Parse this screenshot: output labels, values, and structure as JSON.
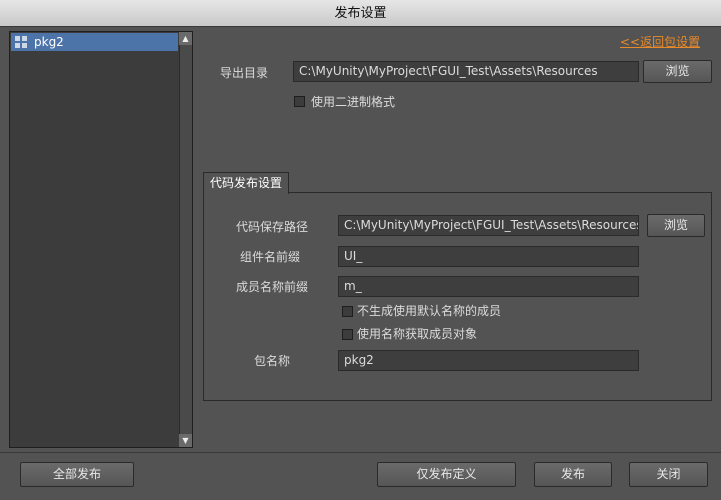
{
  "window": {
    "title": "发布设置"
  },
  "packages": {
    "items": [
      {
        "label": "pkg2",
        "icon": "package-grid-icon"
      }
    ]
  },
  "back_link": "<<返回包设置",
  "export": {
    "label": "导出目录",
    "path": "C:\\MyUnity\\MyProject\\FGUI_Test\\Assets\\Resources",
    "browse": "浏览",
    "binary_format": "使用二进制格式"
  },
  "code": {
    "tab": "代码发布设置",
    "path_label": "代码保存路径",
    "path": "C:\\MyUnity\\MyProject\\FGUI_Test\\Assets\\Resources",
    "browse": "浏览",
    "component_prefix_label": "组件名前缀",
    "component_prefix": "UI_",
    "member_prefix_label": "成员名称前缀",
    "member_prefix": "m_",
    "no_default_name_members": "不生成使用默认名称的成员",
    "get_members_by_name": "使用名称获取成员对象",
    "package_name_label": "包名称",
    "package_name": "pkg2"
  },
  "footer": {
    "publish_all": "全部发布",
    "publish_definition_only": "仅发布定义",
    "publish": "发布",
    "close": "关闭"
  },
  "colors": {
    "background": "#535353",
    "selection": "#4c74a8",
    "link": "#e98a2a"
  }
}
